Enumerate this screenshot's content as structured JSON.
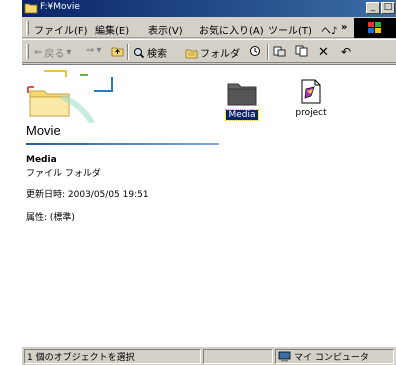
{
  "window": {
    "title": "F:¥Movie"
  },
  "menu": [
    {
      "label": "ファイル(F)"
    },
    {
      "label": "編集(E)"
    },
    {
      "label": "表示(V)"
    },
    {
      "label": "お気に入り(A)"
    },
    {
      "label": "ツール(T)"
    },
    {
      "label": "ヘ♪"
    },
    {
      "label": "»"
    }
  ],
  "toolbar": {
    "back": "戻る",
    "search": "検索",
    "folders": "フォルダ"
  },
  "folder_pane": {
    "title": "Movie",
    "selected_name": "Media",
    "selected_type": "ファイル フォルダ",
    "modified": "更新日時: 2003/05/05 19:51",
    "attributes": "属性: (標準)"
  },
  "items": [
    {
      "label": "Media",
      "selected": true,
      "icon": "folder-icon"
    },
    {
      "label": "project",
      "selected": false,
      "icon": "winamp-file-icon"
    }
  ],
  "statusbar": {
    "selection": "1 個のオブジェクトを選択",
    "location": "マイ コンピュータ"
  },
  "colors": {
    "titlebar_start": "#0a246a",
    "titlebar_end": "#3a6ea5",
    "chrome": "#d4d0c8",
    "selection": "#0a246a"
  }
}
